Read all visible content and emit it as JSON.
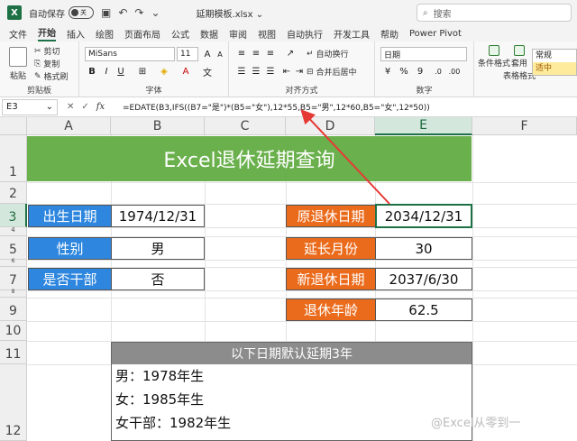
{
  "titlebar": {
    "autosave_label": "自动保存",
    "toggle_state": "关",
    "filename": "延期模板.xlsx",
    "search_placeholder": "搜索"
  },
  "tabs": [
    "文件",
    "开始",
    "插入",
    "绘图",
    "页面布局",
    "公式",
    "数据",
    "审阅",
    "视图",
    "自动执行",
    "开发工具",
    "帮助",
    "Power Pivot"
  ],
  "active_tab": "开始",
  "ribbon": {
    "paste": "粘贴",
    "cut": "剪切",
    "copy": "复制",
    "format_painter": "格式刷",
    "clipboard_label": "剪贴板",
    "font_name": "MiSans",
    "font_size": "11",
    "font_label": "字体",
    "wrap": "自动换行",
    "merge": "合并后居中",
    "align_label": "对齐方式",
    "number_format": "日期",
    "number_label": "数字",
    "cond_format": "条件格式",
    "table_format_1": "套用",
    "table_format_2": "表格格式",
    "style_normal": "常规",
    "style_neutral": "适中"
  },
  "formula_bar": {
    "name_box": "E3",
    "formula": "=EDATE(B3,IFS((B7=\"是\")*(B5=\"女\"),12*55,B5=\"男\",12*60,B5=\"女\",12*50))"
  },
  "columns": [
    "A",
    "B",
    "C",
    "D",
    "E",
    "F"
  ],
  "rows": [
    "1",
    "2",
    "3",
    "4",
    "5",
    "6",
    "7",
    "8",
    "9",
    "10",
    "11",
    "12"
  ],
  "sheet": {
    "title": "Excel退休延期查询",
    "birth_label": "出生日期",
    "birth_value": "1974/12/31",
    "gender_label": "性别",
    "gender_value": "男",
    "cadre_label": "是否干部",
    "cadre_value": "否",
    "orig_label": "原退休日期",
    "orig_value": "2034/12/31",
    "extend_label": "延长月份",
    "extend_value": "30",
    "new_label": "新退休日期",
    "new_value": "2037/6/30",
    "age_label": "退休年龄",
    "age_value": "62.5",
    "note_title": "以下日期默认延期3年",
    "note_lines": [
      "男：1978年生",
      "女：1985年生",
      "女干部：1982年生"
    ]
  },
  "watermark": "@Excel从零到一",
  "colors": {
    "banner": "#6ab04c",
    "blue_label": "#2e86de",
    "orange_label": "#eb6b1c",
    "note_header": "#8c8c8c",
    "excel_green": "#1e7145"
  }
}
